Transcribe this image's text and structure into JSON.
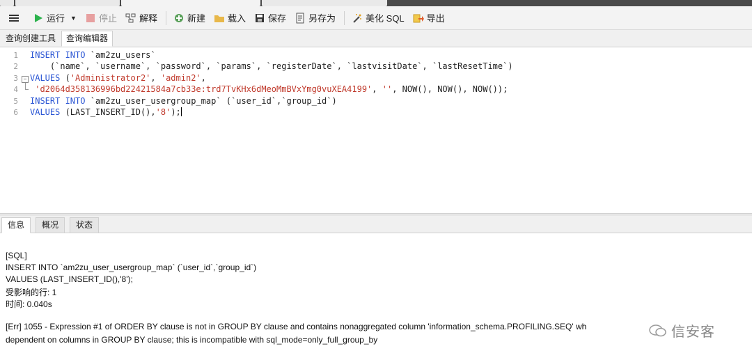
{
  "toolbar": {
    "run_label": "运行",
    "stop_label": "停止",
    "explain_label": "解释",
    "new_label": "新建",
    "load_label": "载入",
    "save_label": "保存",
    "saveas_label": "另存为",
    "beautify_label": "美化 SQL",
    "export_label": "导出"
  },
  "subtabs": {
    "builder": "查询创建工具",
    "editor": "查询编辑器"
  },
  "editor": {
    "line_numbers": [
      "1",
      "2",
      "3",
      "4",
      "5",
      "6"
    ],
    "lines": [
      {
        "kw1": "INSERT INTO",
        "rest": " `am2zu_users`"
      },
      {
        "text": "    (`name`, `username`, `password`, `params`, `registerDate`, `lastvisitDate`, `lastResetTime`)"
      },
      {
        "kw1": "VALUES",
        "p1": " (",
        "s1": "'Administrator2'",
        "p2": ", ",
        "s2": "'admin2'",
        "p3": ","
      },
      {
        "s1": " 'd2064d358136996bd22421584a7cb33e:trd7TvKHx6dMeoMmBVxYmg0vuXEA4199'",
        "p1": ", ",
        "s2": "''",
        "p2": ", NOW(), NOW(), NOW());"
      },
      {
        "kw1": "INSERT INTO",
        "rest": " `am2zu_user_usergroup_map` (`user_id`,`group_id`)"
      },
      {
        "kw1": "VALUES",
        "p1": " (LAST_INSERT_ID(),",
        "s1": "'8'",
        "p2": ");"
      }
    ]
  },
  "bottom_tabs": {
    "info": "信息",
    "overview": "概况",
    "status": "状态"
  },
  "messages": {
    "l1": "[SQL]",
    "l2": "INSERT INTO `am2zu_user_usergroup_map` (`user_id`,`group_id`)",
    "l3": "VALUES (LAST_INSERT_ID(),'8');",
    "l4": "受影响的行: 1",
    "l5": "时间: 0.040s",
    "l6": "[Err] 1055 - Expression #1 of ORDER BY clause is not in GROUP BY clause and contains nonaggregated column 'information_schema.PROFILING.SEQ' wh",
    "l7": "dependent on columns in GROUP BY clause; this is incompatible with sql_mode=only_full_group_by"
  },
  "watermark": {
    "text": "信安客"
  },
  "colors": {
    "keyword": "#2a55d4",
    "string": "#c0392b",
    "run_green": "#2bb24c"
  }
}
